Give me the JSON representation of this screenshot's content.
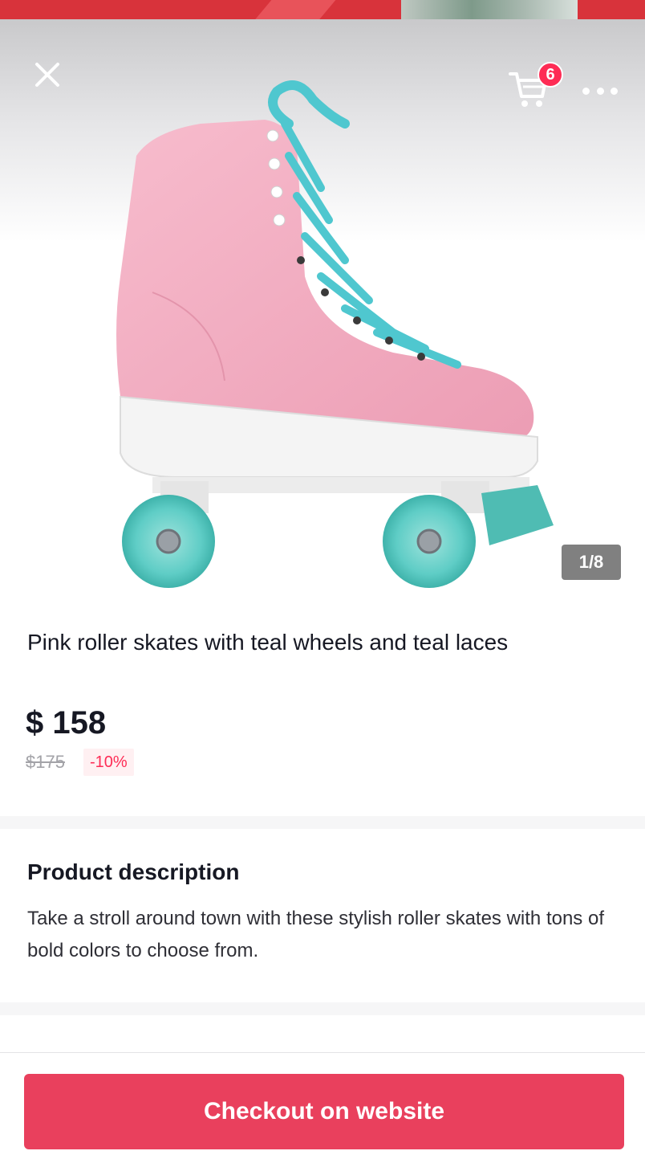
{
  "header": {
    "close_icon": "close-icon",
    "cart_icon": "cart-icon",
    "cart_count": "6",
    "more_icon": "more-icon"
  },
  "gallery": {
    "page_indicator": "1/8"
  },
  "product": {
    "title": "Pink roller skates with teal wheels and teal laces",
    "price": "$ 158",
    "original_price": "$175",
    "discount": "-10%"
  },
  "description": {
    "heading": "Product description",
    "text": "Take a stroll around town with these stylish roller skates with tons of bold colors to choose from."
  },
  "footer": {
    "checkout_label": "Checkout on website"
  },
  "colors": {
    "accent": "#e9405d",
    "badge": "#fe2c55",
    "skate_pink": "#f2a9c0",
    "skate_teal": "#5fcdc6"
  }
}
